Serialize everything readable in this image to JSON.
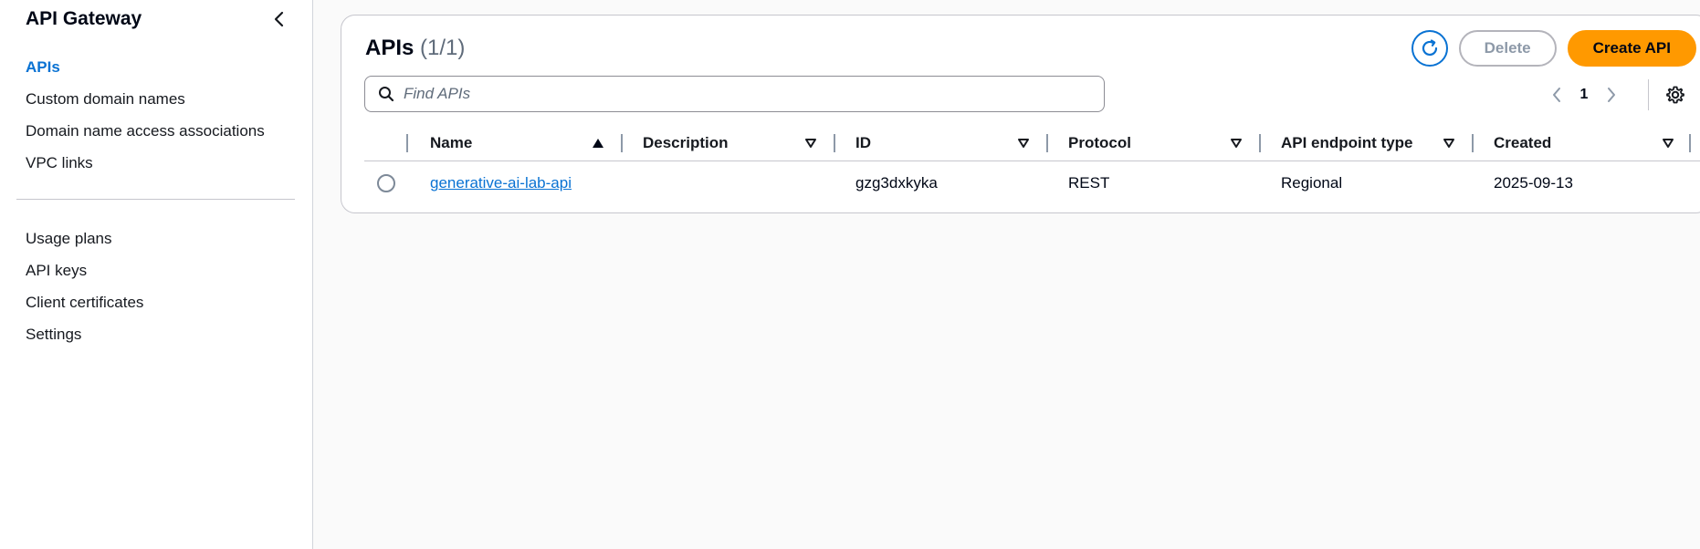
{
  "sidebar": {
    "title": "API Gateway",
    "items_primary": [
      {
        "label": "APIs",
        "active": true
      },
      {
        "label": "Custom domain names"
      },
      {
        "label": "Domain name access associations"
      },
      {
        "label": "VPC links"
      }
    ],
    "items_secondary": [
      {
        "label": "Usage plans"
      },
      {
        "label": "API keys"
      },
      {
        "label": "Client certificates"
      },
      {
        "label": "Settings"
      }
    ]
  },
  "main": {
    "title": "APIs",
    "count": "(1/1)",
    "buttons": {
      "delete": "Delete",
      "create": "Create API"
    },
    "search": {
      "placeholder": "Find APIs",
      "value": ""
    },
    "pagination": {
      "current_page": "1"
    },
    "table": {
      "columns": [
        "Name",
        "Description",
        "ID",
        "Protocol",
        "API endpoint type",
        "Created"
      ],
      "rows": [
        {
          "name": "generative-ai-lab-api",
          "description": "",
          "id": "gzg3dxkyka",
          "protocol": "REST",
          "endpoint_type": "Regional",
          "created": "2025-09-13"
        }
      ]
    }
  },
  "colors": {
    "accent": "#0972d3",
    "primary_button": "#ff9900",
    "text": "#000716",
    "border": "#c6c6cd"
  },
  "icons": [
    "collapse-chevron-left-icon",
    "refresh-icon",
    "search-icon",
    "chevron-left-icon",
    "chevron-right-icon",
    "settings-gear-icon",
    "sort-ascending-icon",
    "sort-descending-icon"
  ]
}
